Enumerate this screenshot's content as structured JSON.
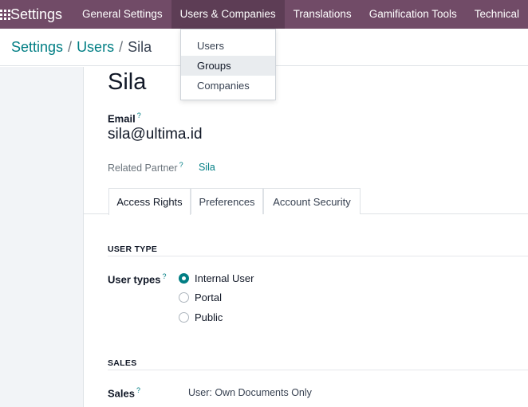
{
  "navbar": {
    "brand": "Settings",
    "menus": [
      "General Settings",
      "Users & Companies",
      "Translations",
      "Gamification Tools",
      "Technical"
    ]
  },
  "breadcrumb": {
    "items": [
      "Settings",
      "Users"
    ],
    "current": "Sila"
  },
  "dropdown": {
    "items": [
      "Users",
      "Groups",
      "Companies"
    ]
  },
  "record": {
    "name": "Sila",
    "email_label": "Email",
    "email_value": "sila@ultima.id",
    "partner_label": "Related Partner",
    "partner_value": "Sila",
    "help_mark": "?"
  },
  "tabs": [
    "Access Rights",
    "Preferences",
    "Account Security"
  ],
  "user_type": {
    "section_title": "USER TYPE",
    "label": "User types",
    "options": [
      "Internal User",
      "Portal",
      "Public"
    ],
    "selected": "Internal User"
  },
  "sales": {
    "section_title": "SALES",
    "label": "Sales",
    "value": "User: Own Documents Only"
  },
  "colors": {
    "navbar": "#714b67",
    "accent": "#017e84"
  }
}
